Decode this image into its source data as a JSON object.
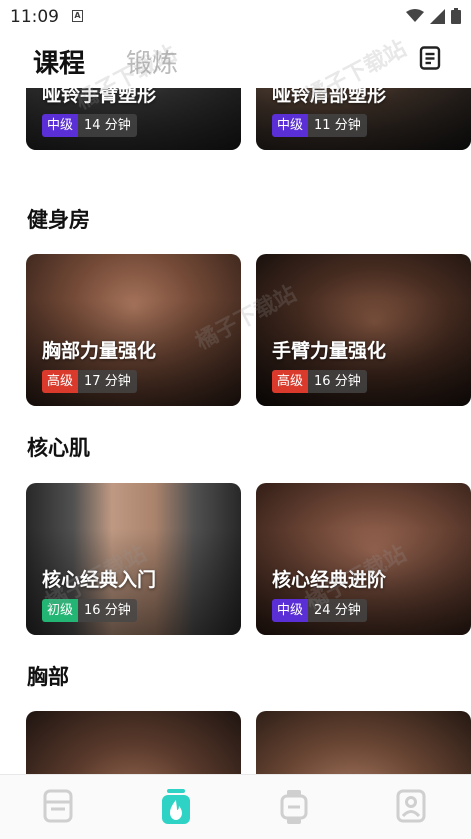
{
  "status_bar": {
    "time": "11:09",
    "notification_letter": "A"
  },
  "header": {
    "tabs": [
      {
        "label": "课程",
        "active": true
      },
      {
        "label": "锻炼",
        "active": false
      }
    ],
    "list_icon": "document-list-icon"
  },
  "colors": {
    "badge_intermediate": "#5b2fd6",
    "badge_advanced": "#d93a2b",
    "badge_beginner": "#23b574",
    "nav_active": "#2fd3c6",
    "nav_inactive": "#cfcfcf"
  },
  "sections": [
    {
      "title": "",
      "cards": [
        {
          "title": "哑铃手臂塑形",
          "level": "中级",
          "duration": "14 分钟"
        },
        {
          "title": "哑铃肩部塑形",
          "level": "中级",
          "duration": "11 分钟"
        }
      ]
    },
    {
      "title": "健身房",
      "cards": [
        {
          "title": "胸部力量强化",
          "level": "高级",
          "duration": "17 分钟"
        },
        {
          "title": "手臂力量强化",
          "level": "高级",
          "duration": "16 分钟"
        }
      ]
    },
    {
      "title": "核心肌",
      "cards": [
        {
          "title": "核心经典入门",
          "level": "初级",
          "duration": "16 分钟"
        },
        {
          "title": "核心经典进阶",
          "level": "中级",
          "duration": "24 分钟"
        }
      ]
    },
    {
      "title": "胸部",
      "cards": [
        {
          "title": "",
          "level": "",
          "duration": ""
        },
        {
          "title": "",
          "level": "",
          "duration": ""
        }
      ]
    }
  ],
  "bottom_nav": [
    {
      "icon": "calendar-icon",
      "active": false
    },
    {
      "icon": "fire-icon",
      "active": true
    },
    {
      "icon": "watch-icon",
      "active": false
    },
    {
      "icon": "profile-icon",
      "active": false
    }
  ],
  "watermark": "橘子下载站"
}
